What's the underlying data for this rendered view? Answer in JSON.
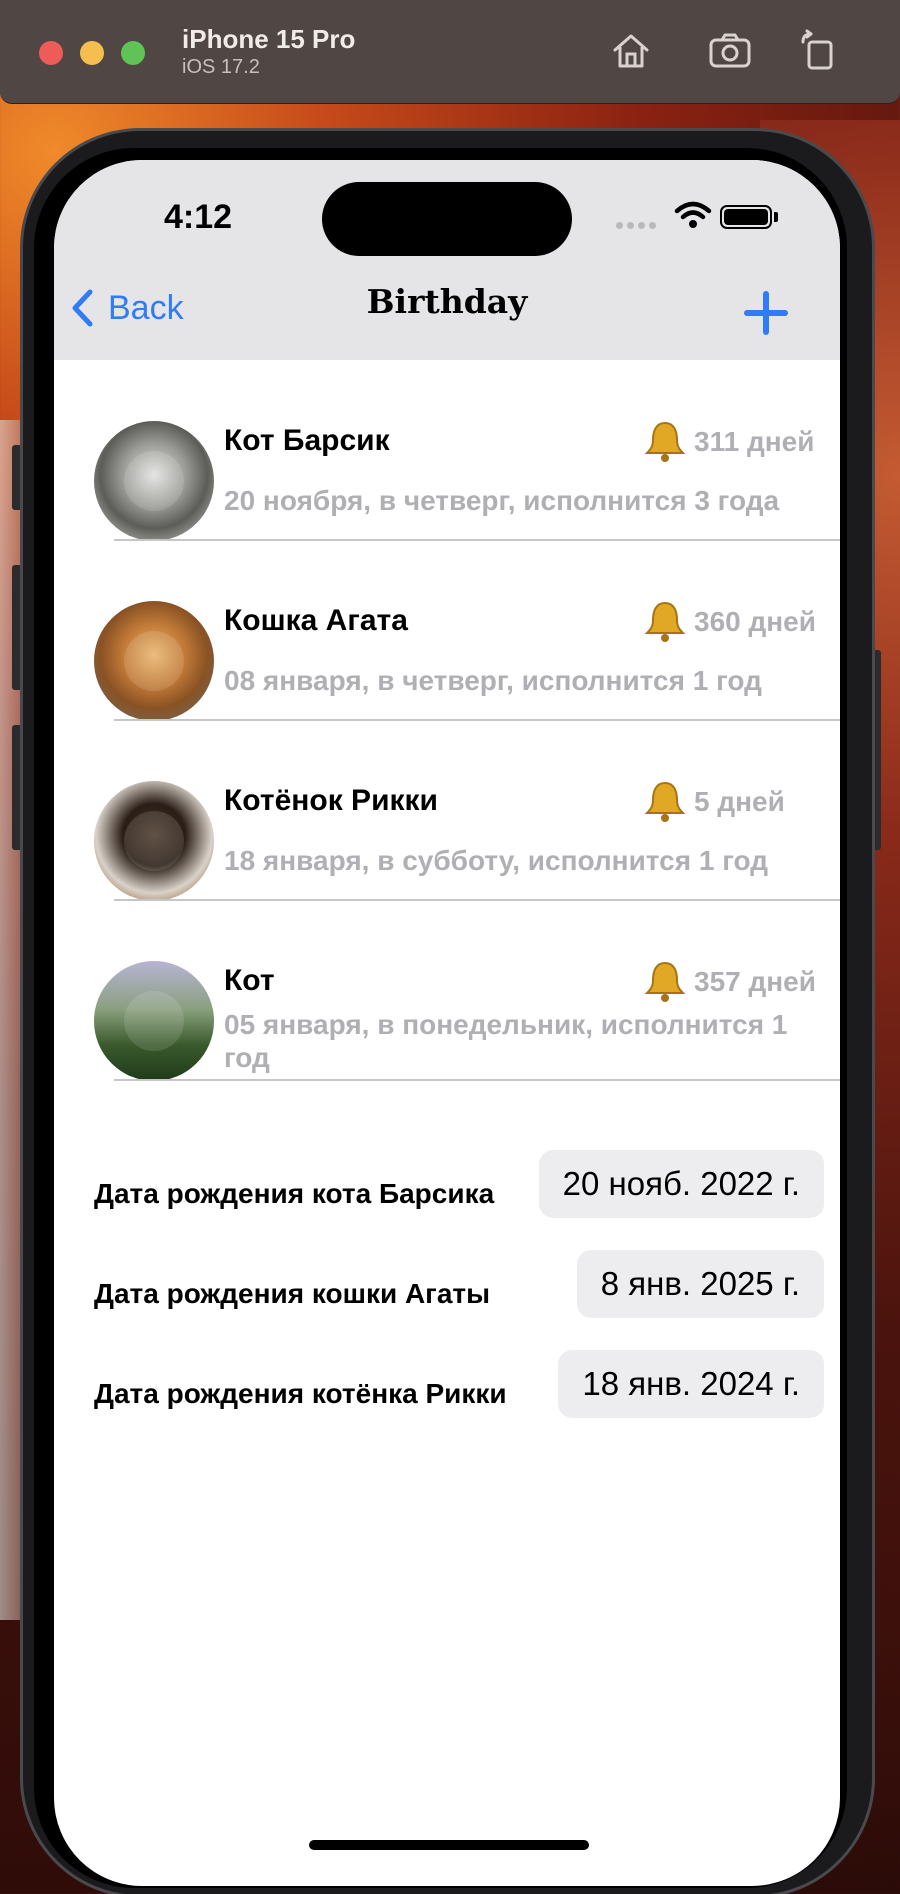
{
  "simulator": {
    "device": "iPhone 15 Pro",
    "os": "iOS 17.2",
    "buttons": [
      "home-icon",
      "screenshot-icon",
      "rotate-icon"
    ]
  },
  "status": {
    "time": "4:12"
  },
  "nav": {
    "back_label": "Back",
    "title": "Birthday",
    "add_icon": "plus-icon"
  },
  "pets": [
    {
      "name": "Кот Барсик",
      "days": "311 дней",
      "info": "20 ноября, в четверг, исполнится 3 года"
    },
    {
      "name": "Кошка Агата",
      "days": "360 дней",
      "info": "08 января, в четверг, исполнится 1 год"
    },
    {
      "name": "Котёнок Рикки",
      "days": "5 дней",
      "info": "18 января, в субботу, исполнится 1 год"
    },
    {
      "name": "Кот",
      "days": "357 дней",
      "info": "05 января, в понедельник, исполнится 1 год"
    }
  ],
  "pickers": [
    {
      "label": "Дата рождения кота Барсика",
      "value": "20 нояб. 2022 г."
    },
    {
      "label": "Дата рождения кошки Агаты",
      "value": "8 янв. 2025 г."
    },
    {
      "label": "Дата рождения котёнка Рикки",
      "value": "18 янв. 2024 г."
    }
  ],
  "colors": {
    "accent": "#2f7cf6",
    "secondary_text": "#b0b0b4",
    "nav_bg": "#e5e5e7",
    "bell": "#e0a824"
  }
}
